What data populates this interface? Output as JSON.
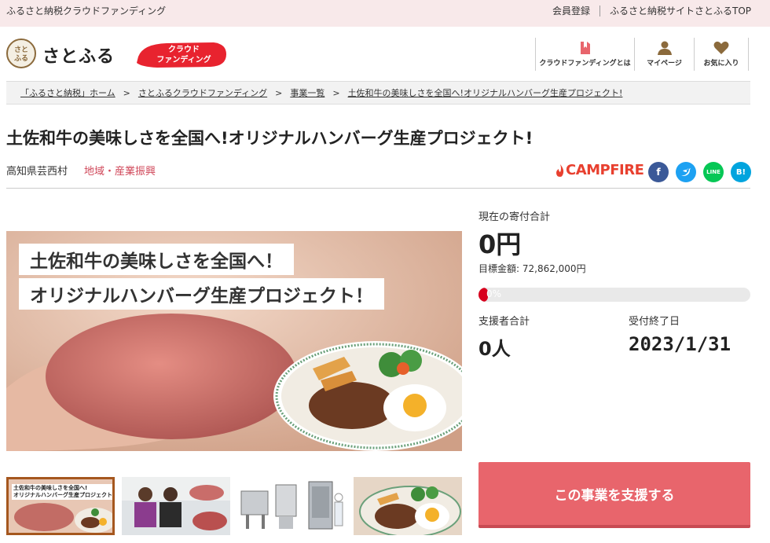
{
  "topbar": {
    "site_title": "ふるさと納税クラウドファンディング",
    "member_link": "会員登録",
    "top_link": "ふるさと納税サイトさとふるTOP"
  },
  "header": {
    "logo_mark": "さとふる",
    "logo_text": "さとふる",
    "badge_line1": "クラウド",
    "badge_line2": "ファンディング",
    "nav": [
      {
        "label": "クラウドファンディングとは",
        "icon": "book-icon"
      },
      {
        "label": "マイページ",
        "icon": "person-icon"
      },
      {
        "label": "お気に入り",
        "icon": "heart-icon"
      }
    ]
  },
  "breadcrumb": [
    "「ふるさと納税」ホーム",
    "さとふるクラウドファンディング",
    "事業一覧",
    "土佐和牛の美味しさを全国へ!オリジナルハンバーグ生産プロジェクト!"
  ],
  "breadcrumb_sep": ">",
  "project": {
    "title": "土佐和牛の美味しさを全国へ!オリジナルハンバーグ生産プロジェクト!",
    "location": "高知県芸西村",
    "category": "地域・産業振興",
    "partner": "CAMPFIRE",
    "sns": {
      "facebook": "f",
      "twitter": "t",
      "line": "LINE",
      "hatena": "B!"
    }
  },
  "hero": {
    "line1": "土佐和牛の美味しさを全国へ！",
    "line2": "オリジナルハンバーグ生産プロジェクト！"
  },
  "thumbnails": {
    "t1_caption_line1": "土佐和牛の美味しさを全国へ!",
    "t1_caption_line2": "オリジナルハンバーグ生産プロジェクト!"
  },
  "stats": {
    "current_label": "現在の寄付合計",
    "current_amount": "0円",
    "goal_text": "目標金額: 72,862,000円",
    "progress_percent": 0,
    "progress_text": "0%",
    "supporters_label": "支援者合計",
    "supporters_value": "0人",
    "deadline_label": "受付終了日",
    "deadline_value": "2023/1/31"
  },
  "cta": {
    "label": "この事業を支援する"
  },
  "colors": {
    "accent": "#e8656c",
    "topbar_bg": "#f8e9ea",
    "category": "#d0485a",
    "progress": "#d7001d",
    "campfire": "#e8402f"
  }
}
